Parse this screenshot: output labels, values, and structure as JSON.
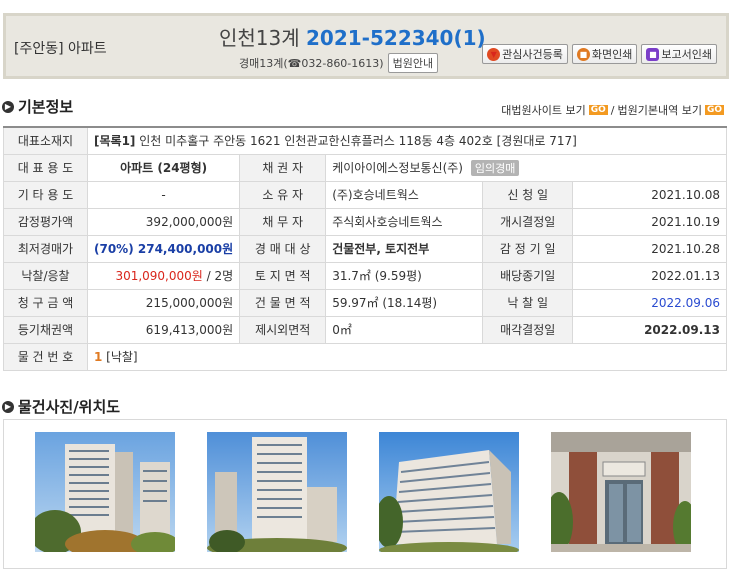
{
  "header": {
    "region": "[주안동] 아파트",
    "court_name": "인천13계 ",
    "case_number": "2021-522340(1)",
    "court_line": "경매13계(☎032-860-1613)",
    "court_guide": "법원안내",
    "buttons": {
      "bookmark": "관심사건등록",
      "print_screen": "화면인쇄",
      "print_report": "보고서인쇄"
    }
  },
  "basic_info": {
    "title": "기본정보",
    "link_court_site": "대법원사이트 보기",
    "link_court_detail": "법원기본내역 보기",
    "go": "GO",
    "separator": "/"
  },
  "table": {
    "address_label": "대표소재지",
    "address_tag": "[목록1]",
    "address_text": " 인천 미추홀구 주안동 1621 인천관교한신휴플러스 118동 4층 402호 [경원대로 717]",
    "rows": [
      {
        "l1": "대 표 용 도",
        "v1": "아파트 (24평형)",
        "l2": "채 권 자",
        "v2": "케이아이에스정보통신(주)",
        "badge": "임의경매"
      },
      {
        "l1": "기 타 용 도",
        "v1": "-",
        "l2": "소 유 자",
        "v2": "(주)호승네트웍스",
        "l3": "신 청 일",
        "v3": "2021.10.08"
      },
      {
        "l1": "감정평가액",
        "v1": "392,000,000원",
        "l2": "채 무 자",
        "v2": "주식회사호승네트웍스",
        "l3": "개시결정일",
        "v3": "2021.10.19"
      },
      {
        "l1": "최저경매가",
        "v1": "(70%) 274,400,000원",
        "l2": "경 매 대 상",
        "v2": "건물전부, 토지전부",
        "l3": "감 정 기 일",
        "v3": "2021.10.28"
      },
      {
        "l1": "낙찰/응찰",
        "v1_price": "301,090,000원",
        "v1_rest": " / 2명",
        "l2": "토 지 면 적",
        "v2": "31.7㎡ (9.59평)",
        "l3": "배당종기일",
        "v3": "2022.01.13"
      },
      {
        "l1": "청 구 금 액",
        "v1": "215,000,000원",
        "l2": "건 물 면 적",
        "v2": "59.97㎡ (18.14평)",
        "l3": "낙 찰 일",
        "v3": "2022.09.06"
      },
      {
        "l1": "등기채권액",
        "v1": "619,413,000원",
        "l2": "제시외면적",
        "v2": "0㎡",
        "l3": "매각결정일",
        "v3": "2022.09.13"
      }
    ],
    "item_label": "물 건 번 호",
    "item_num": "1",
    "item_status": " [낙찰]"
  },
  "photos": {
    "title": "물건사진/위치도",
    "items": [
      "apartment-photo-1",
      "apartment-photo-2",
      "apartment-photo-3",
      "entrance-photo-4"
    ]
  }
}
